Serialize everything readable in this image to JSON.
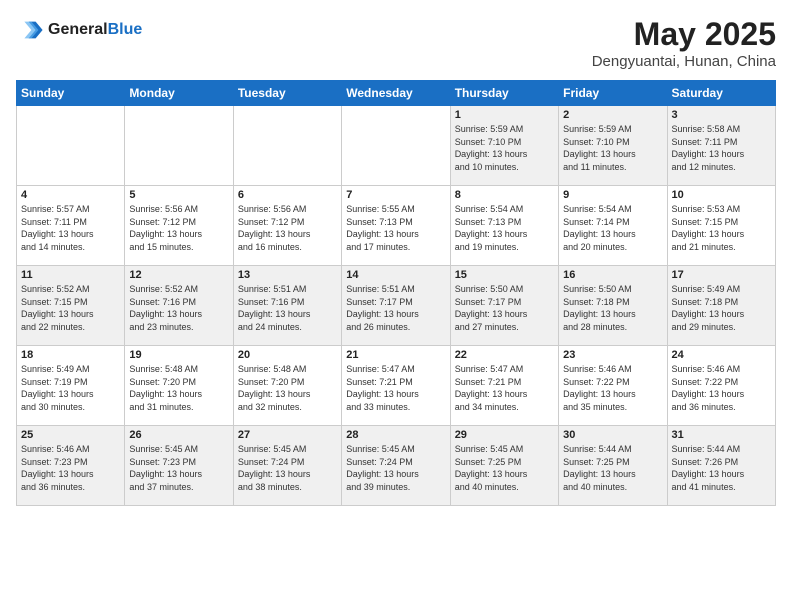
{
  "header": {
    "logo_line1": "General",
    "logo_line2": "Blue",
    "month": "May 2025",
    "location": "Dengyuantai, Hunan, China"
  },
  "weekdays": [
    "Sunday",
    "Monday",
    "Tuesday",
    "Wednesday",
    "Thursday",
    "Friday",
    "Saturday"
  ],
  "weeks": [
    [
      {
        "day": "",
        "info": ""
      },
      {
        "day": "",
        "info": ""
      },
      {
        "day": "",
        "info": ""
      },
      {
        "day": "",
        "info": ""
      },
      {
        "day": "1",
        "info": "Sunrise: 5:59 AM\nSunset: 7:10 PM\nDaylight: 13 hours\nand 10 minutes."
      },
      {
        "day": "2",
        "info": "Sunrise: 5:59 AM\nSunset: 7:10 PM\nDaylight: 13 hours\nand 11 minutes."
      },
      {
        "day": "3",
        "info": "Sunrise: 5:58 AM\nSunset: 7:11 PM\nDaylight: 13 hours\nand 12 minutes."
      }
    ],
    [
      {
        "day": "4",
        "info": "Sunrise: 5:57 AM\nSunset: 7:11 PM\nDaylight: 13 hours\nand 14 minutes."
      },
      {
        "day": "5",
        "info": "Sunrise: 5:56 AM\nSunset: 7:12 PM\nDaylight: 13 hours\nand 15 minutes."
      },
      {
        "day": "6",
        "info": "Sunrise: 5:56 AM\nSunset: 7:12 PM\nDaylight: 13 hours\nand 16 minutes."
      },
      {
        "day": "7",
        "info": "Sunrise: 5:55 AM\nSunset: 7:13 PM\nDaylight: 13 hours\nand 17 minutes."
      },
      {
        "day": "8",
        "info": "Sunrise: 5:54 AM\nSunset: 7:13 PM\nDaylight: 13 hours\nand 19 minutes."
      },
      {
        "day": "9",
        "info": "Sunrise: 5:54 AM\nSunset: 7:14 PM\nDaylight: 13 hours\nand 20 minutes."
      },
      {
        "day": "10",
        "info": "Sunrise: 5:53 AM\nSunset: 7:15 PM\nDaylight: 13 hours\nand 21 minutes."
      }
    ],
    [
      {
        "day": "11",
        "info": "Sunrise: 5:52 AM\nSunset: 7:15 PM\nDaylight: 13 hours\nand 22 minutes."
      },
      {
        "day": "12",
        "info": "Sunrise: 5:52 AM\nSunset: 7:16 PM\nDaylight: 13 hours\nand 23 minutes."
      },
      {
        "day": "13",
        "info": "Sunrise: 5:51 AM\nSunset: 7:16 PM\nDaylight: 13 hours\nand 24 minutes."
      },
      {
        "day": "14",
        "info": "Sunrise: 5:51 AM\nSunset: 7:17 PM\nDaylight: 13 hours\nand 26 minutes."
      },
      {
        "day": "15",
        "info": "Sunrise: 5:50 AM\nSunset: 7:17 PM\nDaylight: 13 hours\nand 27 minutes."
      },
      {
        "day": "16",
        "info": "Sunrise: 5:50 AM\nSunset: 7:18 PM\nDaylight: 13 hours\nand 28 minutes."
      },
      {
        "day": "17",
        "info": "Sunrise: 5:49 AM\nSunset: 7:18 PM\nDaylight: 13 hours\nand 29 minutes."
      }
    ],
    [
      {
        "day": "18",
        "info": "Sunrise: 5:49 AM\nSunset: 7:19 PM\nDaylight: 13 hours\nand 30 minutes."
      },
      {
        "day": "19",
        "info": "Sunrise: 5:48 AM\nSunset: 7:20 PM\nDaylight: 13 hours\nand 31 minutes."
      },
      {
        "day": "20",
        "info": "Sunrise: 5:48 AM\nSunset: 7:20 PM\nDaylight: 13 hours\nand 32 minutes."
      },
      {
        "day": "21",
        "info": "Sunrise: 5:47 AM\nSunset: 7:21 PM\nDaylight: 13 hours\nand 33 minutes."
      },
      {
        "day": "22",
        "info": "Sunrise: 5:47 AM\nSunset: 7:21 PM\nDaylight: 13 hours\nand 34 minutes."
      },
      {
        "day": "23",
        "info": "Sunrise: 5:46 AM\nSunset: 7:22 PM\nDaylight: 13 hours\nand 35 minutes."
      },
      {
        "day": "24",
        "info": "Sunrise: 5:46 AM\nSunset: 7:22 PM\nDaylight: 13 hours\nand 36 minutes."
      }
    ],
    [
      {
        "day": "25",
        "info": "Sunrise: 5:46 AM\nSunset: 7:23 PM\nDaylight: 13 hours\nand 36 minutes."
      },
      {
        "day": "26",
        "info": "Sunrise: 5:45 AM\nSunset: 7:23 PM\nDaylight: 13 hours\nand 37 minutes."
      },
      {
        "day": "27",
        "info": "Sunrise: 5:45 AM\nSunset: 7:24 PM\nDaylight: 13 hours\nand 38 minutes."
      },
      {
        "day": "28",
        "info": "Sunrise: 5:45 AM\nSunset: 7:24 PM\nDaylight: 13 hours\nand 39 minutes."
      },
      {
        "day": "29",
        "info": "Sunrise: 5:45 AM\nSunset: 7:25 PM\nDaylight: 13 hours\nand 40 minutes."
      },
      {
        "day": "30",
        "info": "Sunrise: 5:44 AM\nSunset: 7:25 PM\nDaylight: 13 hours\nand 40 minutes."
      },
      {
        "day": "31",
        "info": "Sunrise: 5:44 AM\nSunset: 7:26 PM\nDaylight: 13 hours\nand 41 minutes."
      }
    ]
  ]
}
